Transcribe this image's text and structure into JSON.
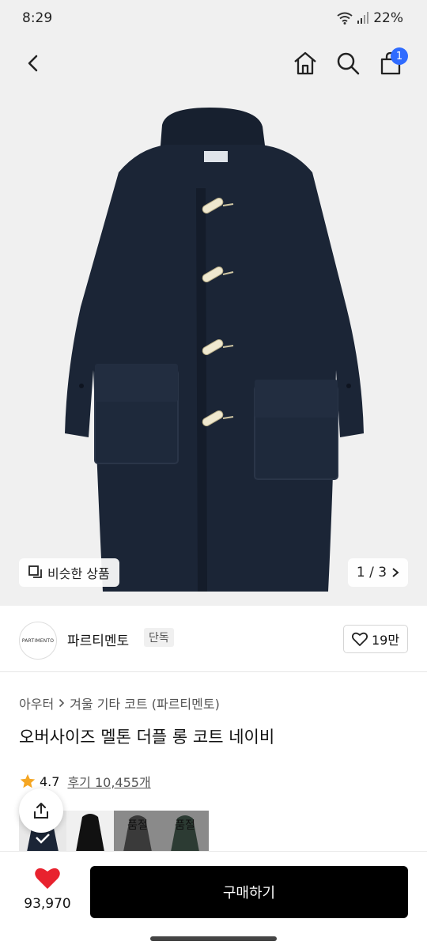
{
  "status_bar": {
    "time": "8:29",
    "battery": "22%"
  },
  "nav": {
    "cart_count": "1"
  },
  "hero": {
    "similar_label": "비슷한 상품",
    "page_indicator": "1 / 3"
  },
  "brand": {
    "logo_text": "PARTIMENTO",
    "name": "파르티멘토",
    "badge": "단독",
    "like_count": "19만"
  },
  "product": {
    "breadcrumb": [
      "아우터",
      "겨울 기타 코트 (파르티멘토)"
    ],
    "title": "오버사이즈 멜톤 더플 롱 코트 네이비",
    "rating": "4.7",
    "reviews": "후기 10,455개"
  },
  "options": {
    "sold_out_label": "품절"
  },
  "bottom": {
    "wish_count": "93,970",
    "buy_label": "구매하기"
  },
  "colors": {
    "accent": "#2f6bff",
    "coat": "#1b2536",
    "heart": "#e8222e",
    "star": "#f5a623"
  }
}
